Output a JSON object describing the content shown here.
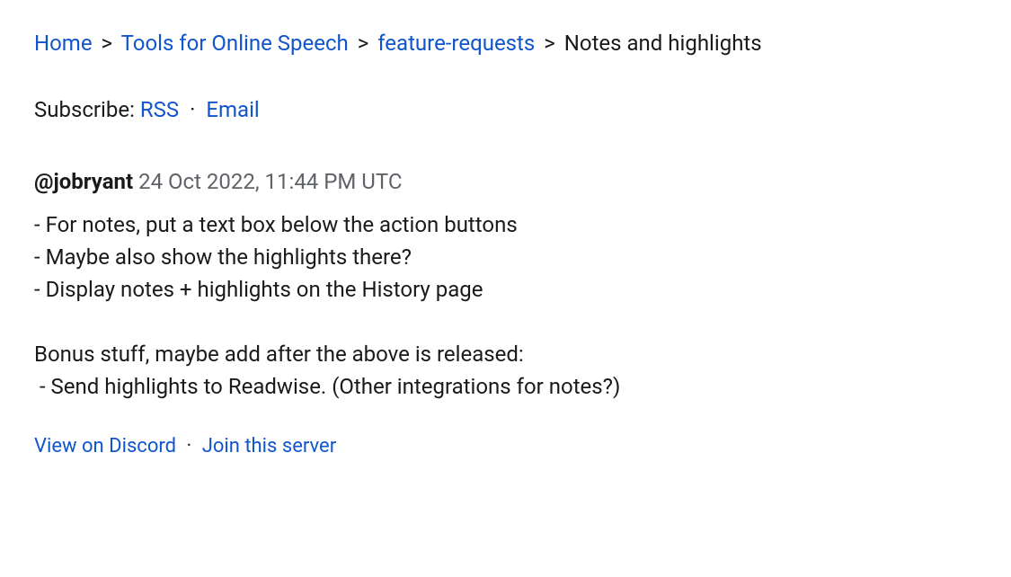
{
  "breadcrumb": {
    "home": "Home",
    "group": "Tools for Online Speech",
    "channel": "feature-requests",
    "current": "Notes and highlights",
    "separator": ">"
  },
  "subscribe": {
    "label": "Subscribe:",
    "rss": "RSS",
    "email": "Email",
    "separator": "·"
  },
  "post": {
    "author": "@jobryant",
    "timestamp": "24 Oct 2022, 11:44 PM UTC",
    "body": "- For notes, put a text box below the action buttons\n- Maybe also show the highlights there?\n- Display notes + highlights on the History page\n\nBonus stuff, maybe add after the above is released:\n - Send highlights to Readwise. (Other integrations for notes?)"
  },
  "footer": {
    "discord": "View on Discord",
    "join": "Join this server",
    "separator": "·"
  }
}
